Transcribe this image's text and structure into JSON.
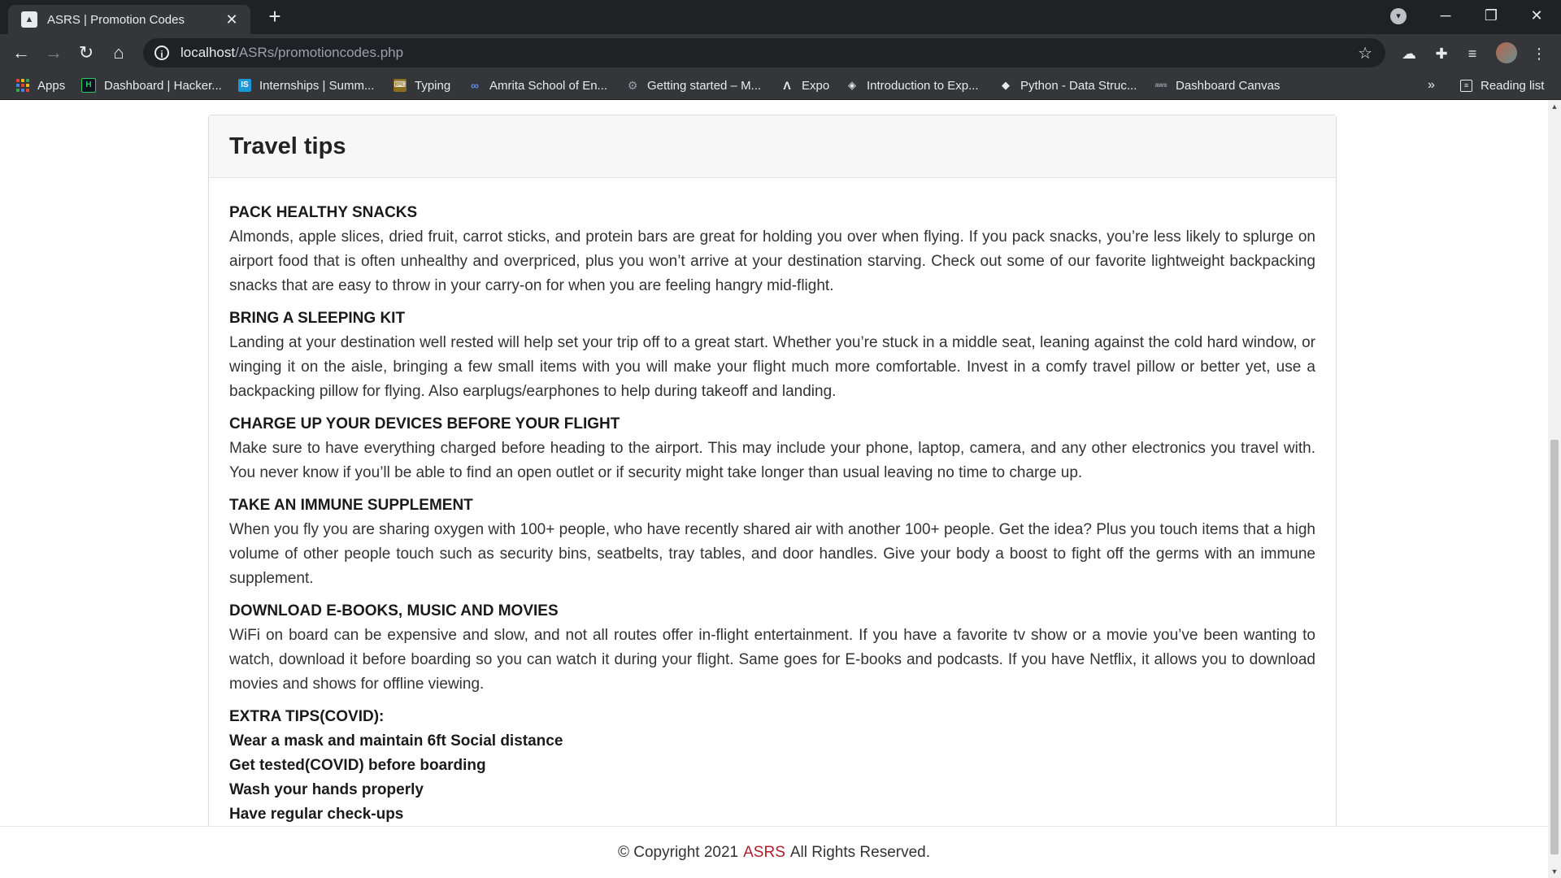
{
  "browser": {
    "tab_title": "ASRS | Promotion Codes",
    "url_host": "localhost",
    "url_path": "/ASRs/promotioncodes.php",
    "bookmarks": [
      {
        "label": "Apps",
        "icon": "apps-grid-icon"
      },
      {
        "label": "Dashboard | Hacker...",
        "icon": "hackerrank-icon"
      },
      {
        "label": "Internships | Summ...",
        "icon": "internshala-icon"
      },
      {
        "label": "Typing",
        "icon": "typing-icon"
      },
      {
        "label": "Amrita School of En...",
        "icon": "amrita-icon"
      },
      {
        "label": "Getting started – M...",
        "icon": "gear-icon"
      },
      {
        "label": "Expo",
        "icon": "expo-icon"
      },
      {
        "label": "Introduction to Exp...",
        "icon": "expo-doc-icon"
      },
      {
        "label": "Python - Data Struc...",
        "icon": "python-icon"
      },
      {
        "label": "Dashboard Canvas",
        "icon": "aws-icon"
      }
    ],
    "more_bookmarks": "»",
    "reading_list": "Reading list"
  },
  "page": {
    "card_title": "Travel tips",
    "tips": [
      {
        "heading": "PACK HEALTHY SNACKS",
        "body": "Almonds, apple slices, dried fruit, carrot sticks, and protein bars are great for holding you over when flying. If you pack snacks, you’re less likely to splurge on airport food that is often unhealthy and overpriced, plus you won’t arrive at your destination starving. Check out some of our favorite lightweight backpacking snacks that are easy to throw in your carry-on for when you are feeling hangry mid-flight."
      },
      {
        "heading": "BRING A SLEEPING KIT",
        "body": "Landing at your destination well rested will help set your trip off to a great start. Whether you’re stuck in a middle seat, leaning against the cold hard window, or winging it on the aisle, bringing a few small items with you will make your flight much more comfortable. Invest in a comfy travel pillow or better yet, use a backpacking pillow for flying. Also earplugs/earphones to help during takeoff and landing."
      },
      {
        "heading": "CHARGE UP YOUR DEVICES BEFORE YOUR FLIGHT",
        "body": "Make sure to have everything charged before heading to the airport. This may include your phone, laptop, camera, and any other electronics you travel with. You never know if you’ll be able to find an open outlet or if security might take longer than usual leaving no time to charge up."
      },
      {
        "heading": "TAKE AN IMMUNE SUPPLEMENT",
        "body": "When you fly you are sharing oxygen with 100+ people, who have recently shared air with another 100+ people. Get the idea? Plus you touch items that a high volume of other people touch such as security bins, seatbelts, tray tables, and door handles. Give your body a boost to fight off the germs with an immune supplement."
      },
      {
        "heading": "DOWNLOAD E-BOOKS, MUSIC AND MOVIES",
        "body": "WiFi on board can be expensive and slow, and not all routes offer in-flight entertainment. If you have a favorite tv show or a movie you’ve been wanting to watch, download it before boarding so you can watch it during your flight. Same goes for E-books and podcasts. If you have Netflix, it allows you to download movies and shows for offline viewing."
      }
    ],
    "extra_heading": "EXTRA TIPS(COVID):",
    "extra_items": [
      "Wear a mask and maintain 6ft Social distance",
      "Get tested(COVID) before boarding",
      "Wash your hands properly",
      "Have regular check-ups"
    ]
  },
  "footer": {
    "prefix": "© Copyright 2021",
    "brand": "ASRS",
    "suffix": "All Rights Reserved."
  },
  "colors": {
    "brand": "#b01e2a",
    "chrome_dark": "#202124",
    "chrome": "#35363a"
  }
}
